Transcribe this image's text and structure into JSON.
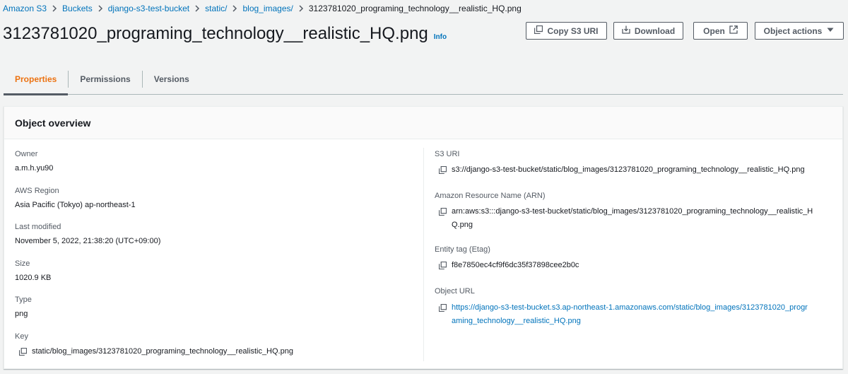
{
  "breadcrumb": {
    "items": [
      "Amazon S3",
      "Buckets",
      "django-s3-test-bucket",
      "static/",
      "blog_images/"
    ],
    "current": "3123781020_programing_technology__realistic_HQ.png"
  },
  "header": {
    "title": "3123781020_programing_technology__realistic_HQ.png",
    "info": "Info"
  },
  "actions": {
    "copy_s3_uri": "Copy S3 URI",
    "download": "Download",
    "open": "Open",
    "object_actions": "Object actions"
  },
  "tabs": [
    {
      "label": "Properties",
      "active": true
    },
    {
      "label": "Permissions",
      "active": false
    },
    {
      "label": "Versions",
      "active": false
    }
  ],
  "overview": {
    "title": "Object overview",
    "left": {
      "owner": {
        "label": "Owner",
        "value": "a.m.h.yu90"
      },
      "region": {
        "label": "AWS Region",
        "value": "Asia Pacific (Tokyo) ap-northeast-1"
      },
      "modified": {
        "label": "Last modified",
        "value": "November 5, 2022, 21:38:20 (UTC+09:00)"
      },
      "size": {
        "label": "Size",
        "value": "1020.9 KB"
      },
      "type": {
        "label": "Type",
        "value": "png"
      },
      "key": {
        "label": "Key",
        "value": "static/blog_images/3123781020_programing_technology__realistic_HQ.png"
      }
    },
    "right": {
      "s3_uri": {
        "label": "S3 URI",
        "value": "s3://django-s3-test-bucket/static/blog_images/3123781020_programing_technology__realistic_HQ.png"
      },
      "arn": {
        "label": "Amazon Resource Name (ARN)",
        "line1": "arn:aws:s3:::django-s3-test-bucket/static/blog_images/3123781020_programing_technology__realistic_H",
        "line2": "Q.png"
      },
      "etag": {
        "label": "Entity tag (Etag)",
        "value": "f8e7850ec4cf9f6dc35f37898cee2b0c"
      },
      "url": {
        "label": "Object URL",
        "line1": "https://django-s3-test-bucket.s3.ap-northeast-1.amazonaws.com/static/blog_images/3123781020_progr",
        "line2": "aming_technology__realistic_HQ.png"
      }
    }
  },
  "colors": {
    "link": "#0073bb",
    "active_tab": "#ec7211",
    "text": "#16191f",
    "muted": "#545b64",
    "background": "#f2f3f3"
  },
  "icons": [
    "chevron-right-icon",
    "copy-icon",
    "download-icon",
    "external-link-icon",
    "caret-down-icon"
  ]
}
